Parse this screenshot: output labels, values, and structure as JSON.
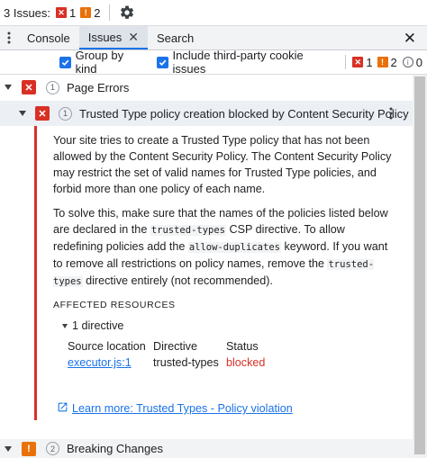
{
  "topbar": {
    "issues_label": "3 Issues:",
    "error_count": "1",
    "warning_count": "2",
    "error_icon": "error-icon",
    "warning_icon": "warning-icon",
    "settings_icon": "gear-icon"
  },
  "tabs": {
    "menu_icon": "kebab-menu-icon",
    "items": [
      {
        "label": "Console",
        "active": false
      },
      {
        "label": "Issues",
        "active": true,
        "closable": true
      },
      {
        "label": "Search",
        "active": false
      }
    ],
    "close_icon": "close-icon"
  },
  "toolbar": {
    "group_by_kind": {
      "label": "Group by kind",
      "checked": true
    },
    "third_party": {
      "label": "Include third-party cookie issues",
      "checked": true
    },
    "error_count": "1",
    "warning_count": "2",
    "info_count": "0"
  },
  "groups": [
    {
      "title": "Page Errors",
      "count": "1",
      "kind": "error",
      "expanded": true
    },
    {
      "title": "Breaking Changes",
      "count": "2",
      "kind": "warning",
      "expanded": true
    }
  ],
  "issue": {
    "count": "1",
    "title": "Trusted Type policy creation blocked by Content Security Policy",
    "para1": "Your site tries to create a Trusted Type policy that has not been allowed by the Content Security Policy. The Content Security Policy may restrict the set of valid names for Trusted Type policies, and forbid more than one policy of each name.",
    "para2_a": "To solve this, make sure that the names of the policies listed below are declared in the ",
    "para2_code1": "trusted-types",
    "para2_b": " CSP directive. To allow redefining policies add the ",
    "para2_code2": "allow-duplicates",
    "para2_c": " keyword. If you want to remove all restrictions on policy names, remove the ",
    "para2_code3": "trusted-types",
    "para2_d": " directive entirely (not recommended).",
    "affected_heading": "AFFECTED RESOURCES",
    "directive_toggle": "1 directive",
    "table": {
      "headers": [
        "Source location",
        "Directive",
        "Status"
      ],
      "rows": [
        [
          "executor.js:1",
          "trusted-types",
          "blocked"
        ]
      ]
    },
    "learn_more": "Learn more: Trusted Types - Policy violation"
  },
  "colors": {
    "error": "#d93025",
    "warning": "#e8710a",
    "accent": "#1a73e8",
    "selected_row": "#ecf0f5"
  }
}
